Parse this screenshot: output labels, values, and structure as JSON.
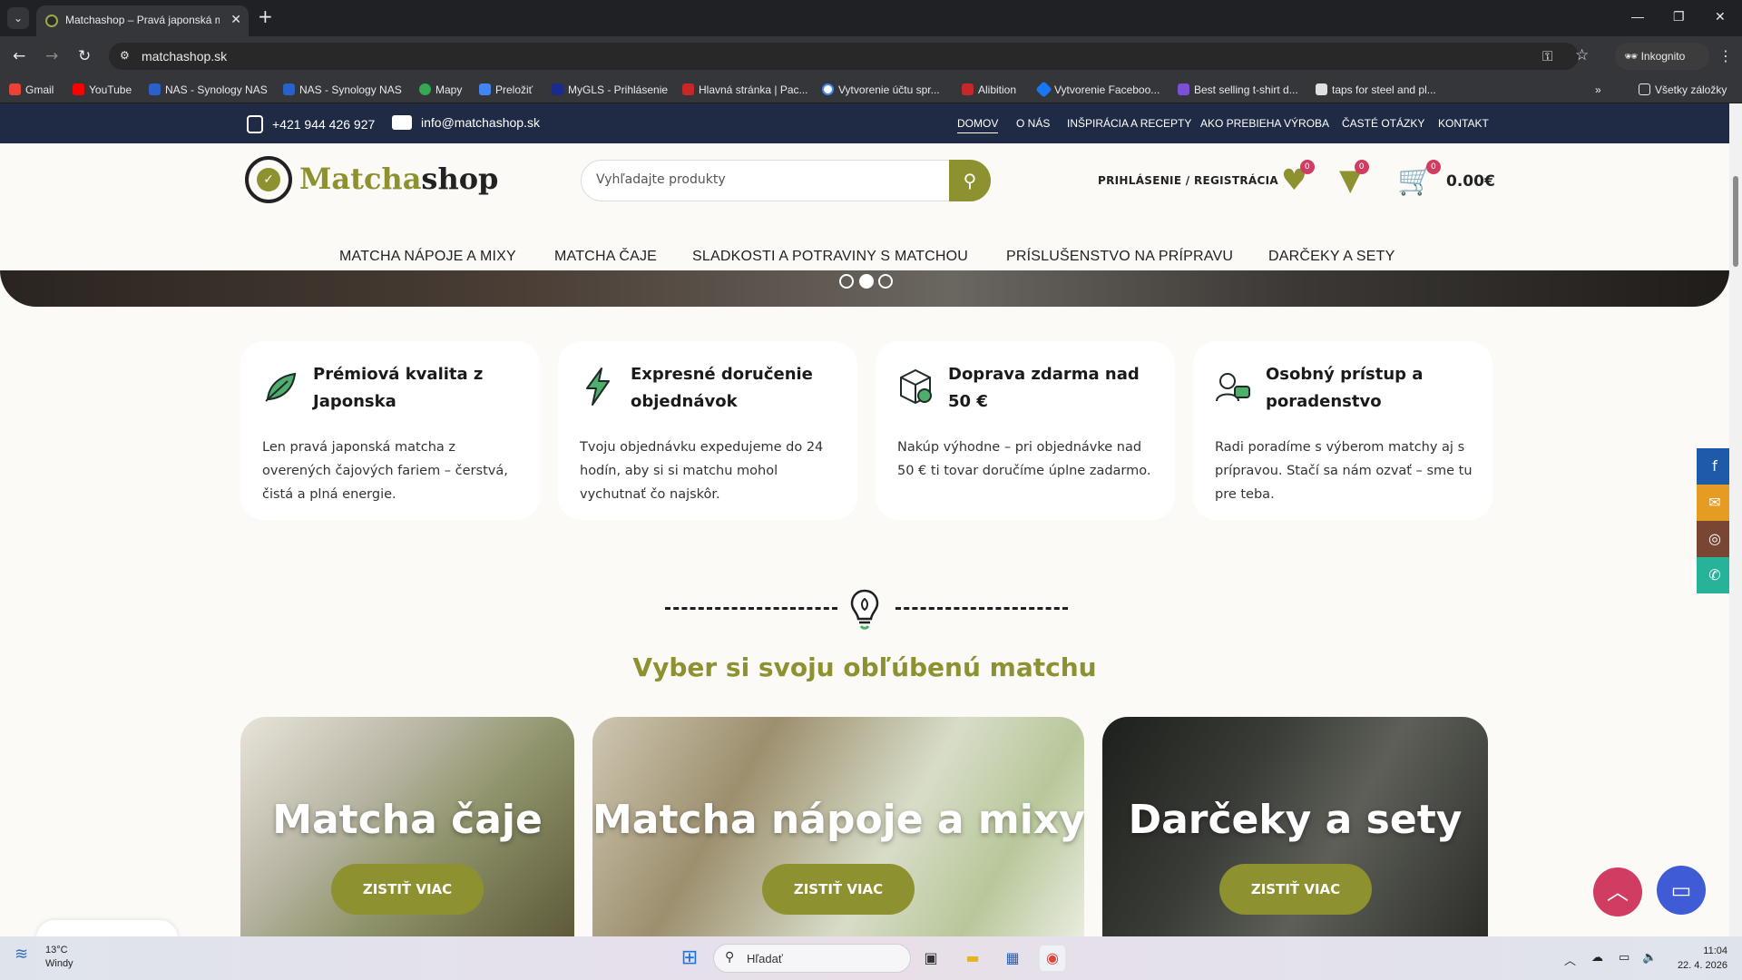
{
  "browser": {
    "tab_title": "Matchashop – Pravá japonská matcha",
    "url": "matchashop.sk",
    "incognito_label": "Inkognito",
    "bookmarks": [
      {
        "label": "Gmail",
        "color": "#ea4335"
      },
      {
        "label": "YouTube",
        "color": "#ff0000"
      },
      {
        "label": "NAS - Synology NAS",
        "color": "#2a61c9"
      },
      {
        "label": "NAS - Synology NAS",
        "color": "#2a61c9"
      },
      {
        "label": "Mapy",
        "color": "#34a853"
      },
      {
        "label": "Preložiť",
        "color": "#4285f4"
      },
      {
        "label": "MyGLS - Prihlásenie",
        "color": "#1c2a8c"
      },
      {
        "label": "Hlavná stránka | Pac...",
        "color": "#c62828"
      },
      {
        "label": "Vytvorenie účtu spr...",
        "color": "#4285f4"
      },
      {
        "label": "Alibition",
        "color": "#c62828"
      },
      {
        "label": "Vytvorenie Faceboo...",
        "color": "#1877f2"
      },
      {
        "label": "Best selling t-shirt d...",
        "color": "#7b4fd6"
      },
      {
        "label": "taps for steel and pl...",
        "color": "#e0e0e0"
      }
    ],
    "all_bookmarks_label": "Všetky záložky"
  },
  "topbar": {
    "phone": "+421 944 426 927",
    "email": "info@matchashop.sk",
    "nav": [
      "DOMOV",
      "O NÁS",
      "INŠPIRÁCIA A RECEPTY",
      "AKO PREBIEHA VÝROBA",
      "ČASTÉ OTÁZKY",
      "KONTAKT"
    ],
    "active_nav": "DOMOV"
  },
  "header": {
    "logo_part1": "Matcha",
    "logo_part2": "shop",
    "search_placeholder": "Vyhľadajte produkty",
    "login_label": "PRIHLÁSENIE / REGISTRÁCIA",
    "wishlist_count": "0",
    "compare_count": "0",
    "cart_count": "0",
    "cart_total": "0.00€"
  },
  "main_nav": [
    "MATCHA NÁPOJE A MIXY",
    "MATCHA ČAJE",
    "SLADKOSTI A POTRAVINY S MATCHOU",
    "PRÍSLUŠENSTVO NA PRÍPRAVU",
    "DARČEKY A SETY"
  ],
  "slider": {
    "active_index": 1,
    "count": 3
  },
  "features": [
    {
      "title": "Prémiová kvalita z Japonska",
      "text": "Len pravá japonská matcha z overených čajových fariem – čerstvá, čistá a plná energie.",
      "icon": "leaf-icon"
    },
    {
      "title": "Expresné doručenie objednávok",
      "text": "Tvoju objednávku expedujeme do 24 hodín, aby si si matchu mohol vychutnať čo najskôr.",
      "icon": "lightning-icon"
    },
    {
      "title": "Doprava zdarma nad 50 €",
      "text": "Nakúp výhodne – pri objednávke nad 50 € ti tovar doručíme úplne zadarmo.",
      "icon": "package-icon"
    },
    {
      "title": "Osobný prístup a poradenstvo",
      "text": "Radi poradíme s výberom matchy aj s prípravou. Stačí sa nám ozvať – sme tu pre teba.",
      "icon": "support-icon"
    }
  ],
  "section_title": "Vyber si svoju obľúbenú matchu",
  "categories": [
    {
      "title": "Matcha čaje",
      "button": "ZISTIŤ VIAC"
    },
    {
      "title": "Matcha nápoje a mixy",
      "button": "ZISTIŤ VIAC"
    },
    {
      "title": "Darčeky a sety",
      "button": "ZISTIŤ VIAC"
    }
  ],
  "social": [
    {
      "icon": "facebook-icon",
      "color": "#1e5aa8"
    },
    {
      "icon": "email-icon",
      "color": "#e69b22"
    },
    {
      "icon": "instagram-icon",
      "color": "#7a4634"
    },
    {
      "icon": "whatsapp-icon",
      "color": "#27b39a"
    }
  ],
  "colors": {
    "accent": "#8d912f",
    "topbar": "#1f2a44",
    "badge": "#d03c62"
  },
  "taskbar": {
    "temp": "13°C",
    "weather": "Windy",
    "search_placeholder": "Hľadať",
    "time": "11:04",
    "date": "22. 4. 2026"
  }
}
